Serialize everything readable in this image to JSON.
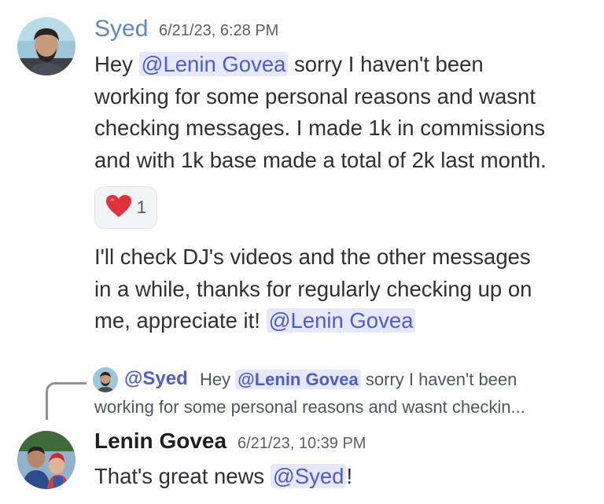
{
  "messages": [
    {
      "author": "Syed",
      "author_color": "#5b86c9",
      "timestamp": "6/21/23, 6:28 PM",
      "line1_pre": "Hey ",
      "line1_mention": "@Lenin Govea",
      "line1_post": " sorry I haven't been",
      "line2": "working for some personal reasons and wasnt",
      "line3": "checking messages. I made 1k in commissions",
      "line4": "and with 1k base made a total of 2k last month.",
      "reaction": {
        "emoji": "❤️",
        "icon": "red-heart-icon",
        "count": "1"
      },
      "followup_line1": "I'll check DJ's videos and the other messages",
      "followup_line2": "in a while, thanks for regularly checking up on",
      "followup_line3_pre": "me, appreciate it! ",
      "followup_mention": "@Lenin Govea"
    },
    {
      "author": "Lenin Govea",
      "author_color": "#1e1f22",
      "timestamp": "6/21/23, 10:39 PM",
      "reply": {
        "name": "@Syed",
        "preview_pre": "Hey ",
        "preview_mention": "@Lenin Govea",
        "preview_post": " sorry I haven't been",
        "preview_line2": "working for some personal reasons and wasnt checkin..."
      },
      "text_pre": "That's great news ",
      "text_mention": "@Syed",
      "text_post": "!"
    }
  ]
}
